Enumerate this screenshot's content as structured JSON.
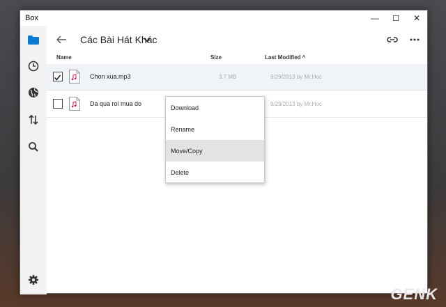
{
  "window": {
    "title": "Box",
    "controls": {
      "minimize": "—",
      "maximize": "☐",
      "close": "✕"
    }
  },
  "sidebar": {
    "icons": [
      "folder-icon",
      "clock-icon",
      "globe-icon",
      "transfer-icon",
      "search-icon",
      "gear-icon"
    ],
    "accent": "#0b79d0"
  },
  "header": {
    "folder_title": "Các Bài Hát Khác"
  },
  "columns": {
    "name": "Name",
    "size": "Size",
    "modified": "Last Modified ^"
  },
  "files": [
    {
      "name": "Chon xua.mp3",
      "size": "3.7 MB",
      "date": "9/29/2013  by Mr.Hoc",
      "checked": true
    },
    {
      "name": "Da qua roi mua do",
      "size": "",
      "date": "9/29/2013  by Mr.Hoc",
      "checked": false
    }
  ],
  "context_menu": {
    "items": [
      "Download",
      "Rename",
      "Move/Copy",
      "Delete"
    ],
    "hovered": "Move/Copy"
  },
  "watermark": "GENK"
}
